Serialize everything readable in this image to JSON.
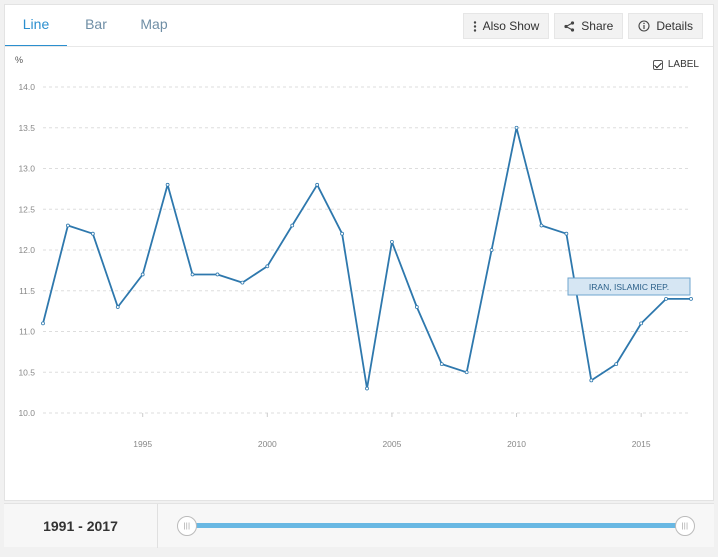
{
  "tabs": [
    {
      "label": "Line",
      "active": true
    },
    {
      "label": "Bar",
      "active": false
    },
    {
      "label": "Map",
      "active": false
    }
  ],
  "toolbar": {
    "also_show": "Also Show",
    "share": "Share",
    "details": "Details"
  },
  "label_toggle": {
    "text": "LABEL",
    "checked": true
  },
  "range": {
    "start": "1991",
    "separator": " - ",
    "end": "2017"
  },
  "colors": {
    "line": "#2e78ad",
    "accent": "#2b8fcf",
    "slider": "#69b8e3"
  },
  "chart_data": {
    "type": "line",
    "ylabel": "%",
    "ylim": [
      10.0,
      14.0
    ],
    "xlim": [
      1991,
      2017
    ],
    "y_ticks": [
      "10.0",
      "10.5",
      "11.0",
      "11.5",
      "12.0",
      "12.5",
      "13.0",
      "13.5",
      "14.0"
    ],
    "x_ticks": [
      "1995",
      "2000",
      "2005",
      "2010",
      "2015"
    ],
    "grid": true,
    "series": [
      {
        "name": "IRAN, ISLAMIC REP.",
        "x": [
          1991,
          1992,
          1993,
          1994,
          1995,
          1996,
          1997,
          1998,
          1999,
          2000,
          2001,
          2002,
          2003,
          2004,
          2005,
          2006,
          2007,
          2008,
          2009,
          2010,
          2011,
          2012,
          2013,
          2014,
          2015,
          2016,
          2017
        ],
        "values": [
          11.1,
          12.3,
          12.2,
          11.3,
          11.7,
          12.8,
          11.7,
          11.7,
          11.6,
          11.8,
          12.3,
          12.8,
          12.2,
          10.3,
          12.1,
          11.3,
          10.6,
          10.5,
          12.0,
          13.5,
          12.3,
          12.2,
          10.4,
          10.6,
          11.1,
          11.4,
          11.4
        ]
      }
    ]
  }
}
